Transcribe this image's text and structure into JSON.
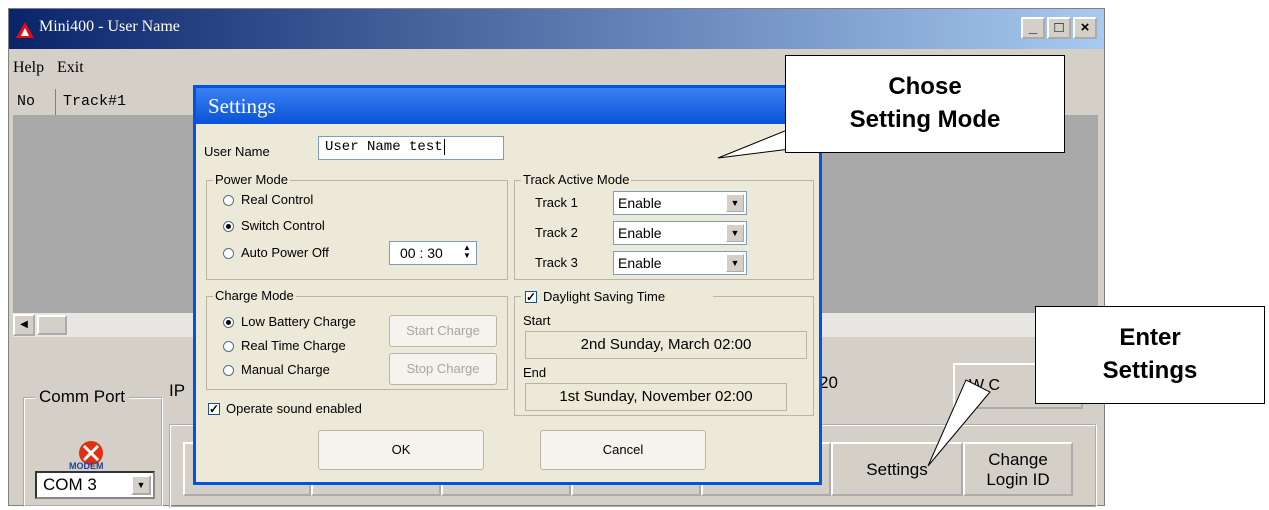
{
  "window": {
    "title": "Mini400  -  User Name",
    "controls": [
      "_",
      "□",
      "×"
    ]
  },
  "menu": {
    "items": [
      "Help",
      "Exit"
    ]
  },
  "list": {
    "columns": [
      "No",
      "Track#1"
    ]
  },
  "background_bits": {
    "ip_label": "IP",
    "status_fragment": "20",
    "partial_button": "W C"
  },
  "comm_port": {
    "label": "Comm Port",
    "icon": "modem-icon",
    "icon_text": "MODEM",
    "selected": "COM 3"
  },
  "bottom_buttons": {
    "settings": "Settings",
    "change_login_line1": "Change",
    "change_login_line2": "Login ID"
  },
  "dialog": {
    "title": "Settings",
    "user_name_label": "User Name",
    "user_name_value": "User Name test",
    "power_mode": {
      "label": "Power Mode",
      "options": [
        "Real Control",
        "Switch Control",
        "Auto Power Off"
      ],
      "selected": "Switch Control",
      "auto_off_time": "00 : 30"
    },
    "track_active_mode": {
      "label": "Track Active Mode",
      "tracks": [
        {
          "label": "Track 1",
          "value": "Enable"
        },
        {
          "label": "Track 2",
          "value": "Enable"
        },
        {
          "label": "Track 3",
          "value": "Enable"
        }
      ]
    },
    "charge_mode": {
      "label": "Charge Mode",
      "options": [
        "Low Battery Charge",
        "Real Time Charge",
        "Manual Charge"
      ],
      "selected": "Low Battery Charge",
      "start_button": "Start Charge",
      "stop_button": "Stop Charge"
    },
    "daylight": {
      "label": "Daylight Saving Time",
      "checked": true,
      "start_label": "Start",
      "start_value": "2nd Sunday, March 02:00",
      "end_label": "End",
      "end_value": "1st Sunday, November 02:00"
    },
    "sound": {
      "label": "Operate sound enabled",
      "checked": true
    },
    "ok": "OK",
    "cancel": "Cancel"
  },
  "callouts": {
    "setting_mode_line1": "Chose",
    "setting_mode_line2": "Setting Mode",
    "enter_line1": "Enter",
    "enter_line2": "Settings"
  },
  "colors": {
    "titlebar": "#0a246a",
    "dialog_title": "#0a52d8",
    "window_face": "#d4d0c8",
    "dialog_face": "#ece9d8"
  }
}
